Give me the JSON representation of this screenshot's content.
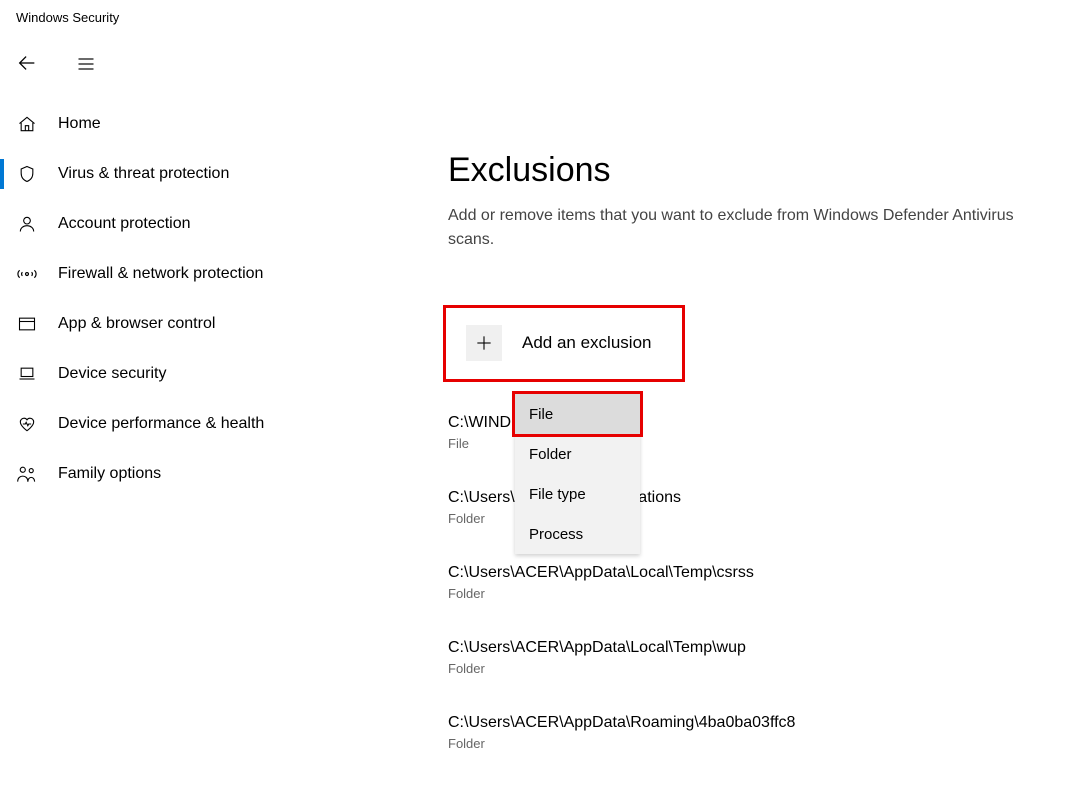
{
  "window": {
    "title": "Windows Security"
  },
  "sidebar": {
    "items": [
      {
        "label": "Home",
        "icon": "home-icon",
        "active": false
      },
      {
        "label": "Virus & threat protection",
        "icon": "shield-icon",
        "active": true
      },
      {
        "label": "Account protection",
        "icon": "person-icon",
        "active": false
      },
      {
        "label": "Firewall & network protection",
        "icon": "signal-icon",
        "active": false
      },
      {
        "label": "App & browser control",
        "icon": "window-icon",
        "active": false
      },
      {
        "label": "Device security",
        "icon": "laptop-icon",
        "active": false
      },
      {
        "label": "Device performance & health",
        "icon": "heart-icon",
        "active": false
      },
      {
        "label": "Family options",
        "icon": "family-icon",
        "active": false
      }
    ]
  },
  "page": {
    "title": "Exclusions",
    "subtitle": "Add or remove items that you want to exclude from Windows Defender Antivirus scans.",
    "add_btn": "Add an exclusion"
  },
  "dropdown": {
    "items": [
      {
        "label": "File",
        "selected": true
      },
      {
        "label": "Folder",
        "selected": false
      },
      {
        "label": "File type",
        "selected": false
      },
      {
        "label": "Process",
        "selected": false
      }
    ]
  },
  "exclusions": [
    {
      "path": "C:\\WIND                             nder.exe",
      "type": "File"
    },
    {
      "path": "C:\\Users\\                           Celemony\\Separations",
      "type": "Folder"
    },
    {
      "path": "C:\\Users\\ACER\\AppData\\Local\\Temp\\csrss",
      "type": "Folder"
    },
    {
      "path": "C:\\Users\\ACER\\AppData\\Local\\Temp\\wup",
      "type": "Folder"
    },
    {
      "path": "C:\\Users\\ACER\\AppData\\Roaming\\4ba0ba03ffc8",
      "type": "Folder"
    }
  ],
  "colors": {
    "accent": "#0078d4",
    "highlight": "#e60000"
  }
}
